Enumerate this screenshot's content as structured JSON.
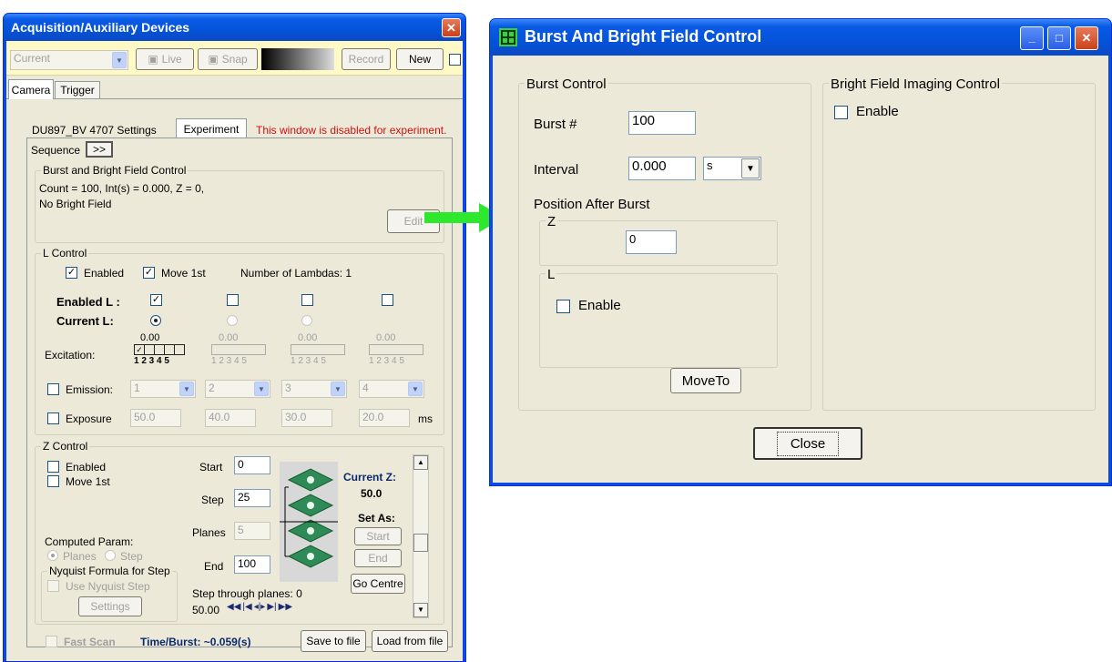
{
  "left_window": {
    "title": "Acquisition/Auxiliary Devices",
    "toolbar": {
      "preset": "Current",
      "live": "Live",
      "snap": "Snap",
      "record": "Record",
      "new": "New"
    },
    "tabs": [
      "Camera",
      "Trigger"
    ],
    "subtabs": [
      "DU897_BV 4707 Settings",
      "Experiment"
    ],
    "disabled_note": "This window is disabled for experiment.",
    "sequence_label": "Sequence",
    "sequence_btn": ">>",
    "burst_group": {
      "title": "Burst and Bright Field Control",
      "line1": "Count = 100, Int(s) = 0.000, Z = 0,",
      "line2": "No Bright Field",
      "edit": "Edit"
    },
    "l_control": {
      "title": "L Control",
      "enabled": "Enabled",
      "move_first": "Move 1st",
      "num_lambdas": "Number of Lambdas: 1",
      "enabled_l": "Enabled L :",
      "current_l": "Current L:",
      "excitation": "Excitation:",
      "exc_values": [
        "0.00",
        "0.00",
        "0.00",
        "0.00"
      ],
      "exc_nums": "1 2 3 4 5",
      "emission": "Emission:",
      "emission_values": [
        "1",
        "2",
        "3",
        "4"
      ],
      "exposure": "Exposure",
      "exposure_values": [
        "50.0",
        "40.0",
        "30.0",
        "20.0"
      ],
      "unit": "ms"
    },
    "z_control": {
      "title": "Z Control",
      "enabled": "Enabled",
      "move_first": "Move 1st",
      "start_label": "Start",
      "start_value": "0",
      "step_label": "Step",
      "step_value": "25",
      "planes_label": "Planes",
      "planes_value": "5",
      "end_label": "End",
      "end_value": "100",
      "current_z_label": "Current Z:",
      "current_z_value": "50.0",
      "set_as": "Set As:",
      "start_btn": "Start",
      "end_btn": "End",
      "go_centre": "Go Centre",
      "computed_param": "Computed Param:",
      "planes_radio": "Planes",
      "step_radio": "Step",
      "nyquist_title": "Nyquist Formula for Step",
      "use_nyquist": "Use Nyquist Step",
      "settings": "Settings",
      "step_through": "Step through planes:  0",
      "position": "50.00"
    },
    "footer": {
      "fast_scan": "Fast Scan",
      "time_burst": "Time/Burst: ~0.059(s)",
      "save": "Save to file",
      "load": "Load from file"
    }
  },
  "right_window": {
    "title": "Burst And Bright Field Control",
    "burst_control": {
      "title": "Burst Control",
      "burst_label": "Burst #",
      "burst_value": "100",
      "interval_label": "Interval",
      "interval_value": "0.000",
      "interval_unit": "s",
      "position_after": "Position After Burst",
      "z_label": "Z",
      "z_value": "0",
      "l_label": "L",
      "l_enable": "Enable",
      "move_to": "MoveTo"
    },
    "bright_field": {
      "title": "Bright Field Imaging Control",
      "enable": "Enable"
    },
    "close": "Close"
  },
  "colors": {
    "arrow": "#2ee82e",
    "warning_text": "#cc1010",
    "titlebar": "#0a5ae6"
  }
}
